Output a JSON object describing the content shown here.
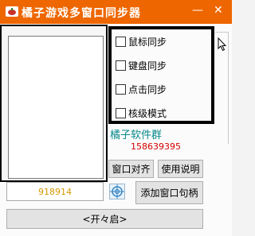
{
  "window": {
    "title": "橘子游戏多窗口同步器",
    "minimize": "—",
    "close": "✕"
  },
  "checkboxes": [
    {
      "label": "鼠标同步",
      "checked": false
    },
    {
      "label": "键盘同步",
      "checked": false
    },
    {
      "label": "点击同步",
      "checked": false
    },
    {
      "label": "核级模式",
      "checked": false
    }
  ],
  "info": {
    "group": "橘子软件群",
    "qq": "158639395"
  },
  "buttons": {
    "align": "窗口对齐",
    "help": "使用说明",
    "add_handle": "添加窗口句柄",
    "start": "<开々启>"
  },
  "handle_field": {
    "value": "918914"
  },
  "colors": {
    "titlebar": "#ee6600",
    "group_text": "#0a8a8a",
    "qq_text": "#d40000",
    "handle_text": "#d39a00"
  },
  "icons": {
    "app": "orange-app-icon",
    "target": "crosshair-target-icon",
    "cursor": "mouse-pointer-icon"
  }
}
